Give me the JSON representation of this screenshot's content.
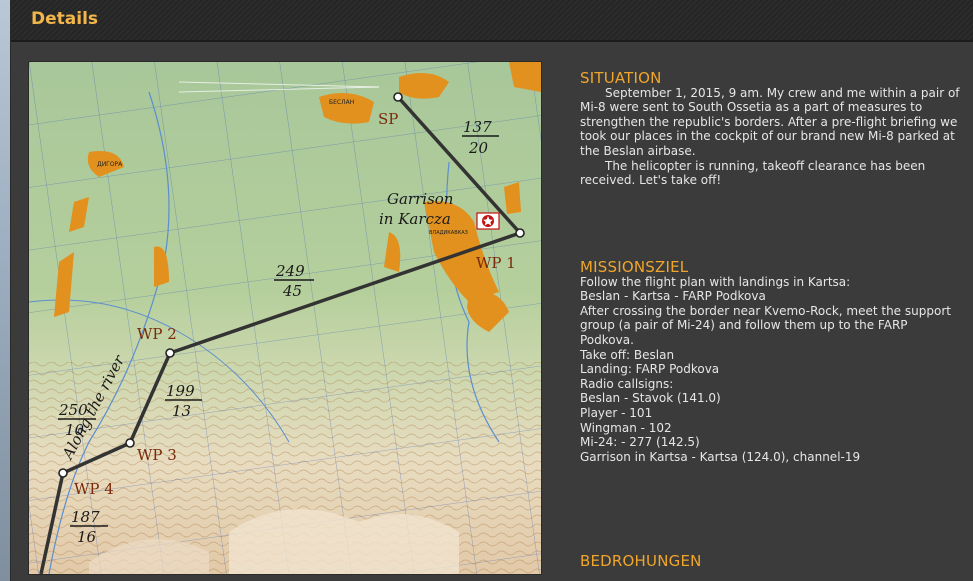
{
  "window": {
    "title": "Details"
  },
  "map": {
    "waypoints": [
      {
        "id": "sp",
        "label": "SP"
      },
      {
        "id": "wp1",
        "label": "WP 1"
      },
      {
        "id": "wp2",
        "label": "WP 2"
      },
      {
        "id": "wp3",
        "label": "WP 3"
      },
      {
        "id": "wp4",
        "label": "WP 4"
      }
    ],
    "legs": [
      {
        "top": "137",
        "bottom": "20"
      },
      {
        "top": "249",
        "bottom": "45"
      },
      {
        "top": "199",
        "bottom": "13"
      },
      {
        "top": "250",
        "bottom": "10"
      },
      {
        "top": "187",
        "bottom": "16"
      }
    ],
    "annotations": {
      "garrison_line1": "Garrison",
      "garrison_line2": "in Karcza",
      "river": "Along the river"
    },
    "place_labels": {
      "beslan": "БЕСЛАН",
      "digora": "ДИГОРА",
      "vladik": "ВЛАДИКАВКАЗ"
    }
  },
  "situation": {
    "heading": "SITUATION",
    "para1": "September 1, 2015, 9 am. My crew and me within a pair of Mi-8 were sent to South Ossetia as a part of measures to strengthen the republic's borders. After a pre-flight briefing we took our places in the cockpit of our brand new Mi-8 parked at the Beslan airbase.",
    "para2": "The helicopter is running, takeoff clearance has been received. Let's take off!"
  },
  "mission": {
    "heading": "MISSIONSZIEL",
    "line1": "Follow the flight plan with landings in Kartsa:",
    "line2": "Beslan - Kartsa - FARP Podkova",
    "line3": "After crossing the border near Kvemo-Rock, meet the support group (a pair of Mi-24) and follow them up to the FARP Podkova.",
    "takeoff": "Take off: Beslan",
    "landing": "Landing: FARP Podkova",
    "radio_title": "Radio callsigns:",
    "radio": [
      "Beslan - Stavok (141.0)",
      "Player - 101",
      "Wingman - 102",
      "Mi-24: - 277 (142.5)",
      "Garrison in Kartsa - Kartsa (124.0), channel-19"
    ]
  },
  "threats": {
    "heading": "BEDROHUNGEN"
  }
}
